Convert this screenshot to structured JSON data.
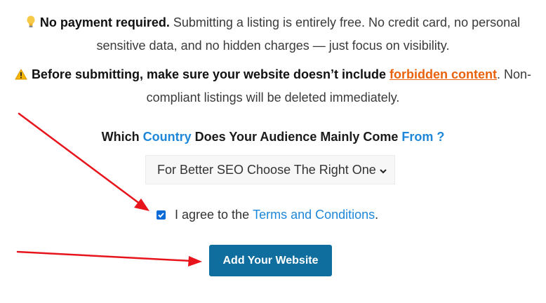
{
  "notices": {
    "payment": {
      "icon": "lightbulb-icon",
      "bold": "No payment required.",
      "text": " Submitting a listing is entirely free. No credit card, no personal sensitive data, and no hidden charges — just focus on visibility."
    },
    "forbidden": {
      "icon": "warning-icon",
      "bold": "Before submitting, make sure your website doesn’t include ",
      "link": "forbidden content",
      "text": ". Non-compliant listings will be deleted immediately."
    }
  },
  "country_question": {
    "part1": "Which ",
    "hl1": "Country",
    "part2": " Does Your Audience Mainly Come ",
    "hl2": "From ?"
  },
  "country_select": {
    "selected": "For Better SEO Choose The Right One",
    "icon": "chevron-down-icon"
  },
  "agreement": {
    "checked": true,
    "prefix": "I agree to the ",
    "link": "Terms and Conditions",
    "suffix": "."
  },
  "submit_button": {
    "label": "Add Your Website"
  },
  "colors": {
    "link_orange": "#e8610c",
    "accent_blue": "#1e87d9",
    "button_bg": "#0f6e9e",
    "arrow_red": "#e8141c"
  }
}
